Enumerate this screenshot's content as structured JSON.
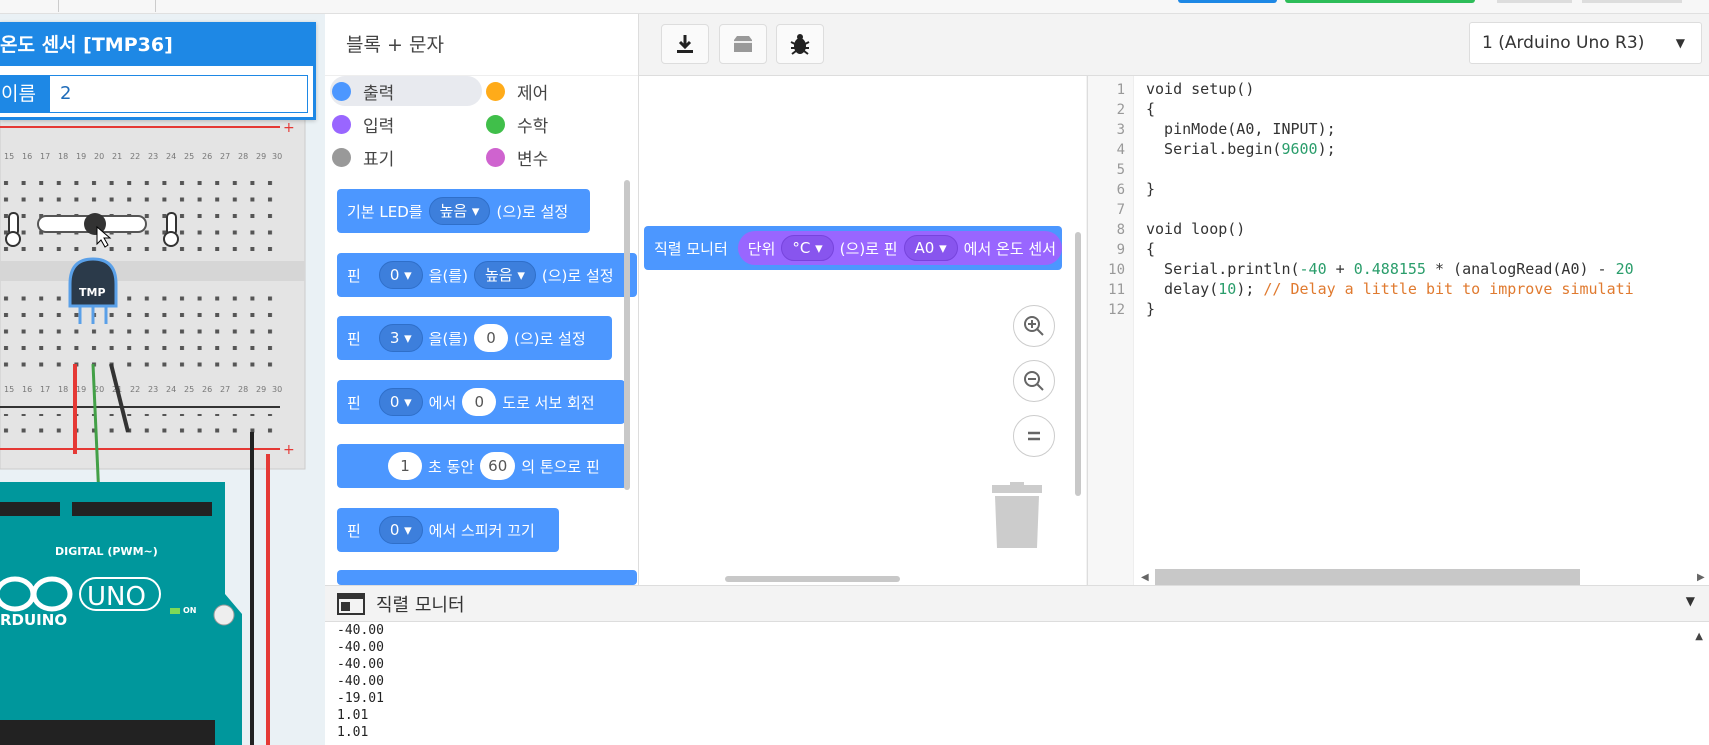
{
  "inspector": {
    "title": "온도 센서 [TMP36]",
    "name_label": "이름",
    "name_value": "2"
  },
  "palette": {
    "header": "블록 + 문자",
    "categories": [
      {
        "label": "출력",
        "color": "#4c97ff"
      },
      {
        "label": "제어",
        "color": "#ffab19"
      },
      {
        "label": "입력",
        "color": "#9966ff"
      },
      {
        "label": "수학",
        "color": "#40bf4a"
      },
      {
        "label": "표기",
        "color": "#999999"
      },
      {
        "label": "변수",
        "color": "#cf63cf"
      }
    ],
    "blocks": {
      "b1": {
        "text1": "기본 LED를",
        "dd1": "높음 ▾",
        "text2": "(으)로 설정"
      },
      "b2": {
        "text1": "핀",
        "dd1": "0 ▾",
        "text2": "을(를)",
        "dd2": "높음 ▾",
        "text3": "(으)로 설정"
      },
      "b3": {
        "text1": "핀",
        "dd1": "3 ▾",
        "text2": "을(를)",
        "num1": "0",
        "text3": "(으)로 설정"
      },
      "b4": {
        "text1": "핀",
        "dd1": "0 ▾",
        "text2": "에서",
        "num1": "0",
        "text3": "도로 서보 회전"
      },
      "b5": {
        "num1": "1",
        "text1": "초 동안",
        "num2": "60",
        "text2": "의 톤으로 핀"
      },
      "b6": {
        "text1": "핀",
        "dd1": "0 ▾",
        "text2": "에서 스피커 끄기"
      }
    }
  },
  "board_select": {
    "value": "1 (Arduino Uno R3)"
  },
  "workspace": {
    "serial_block": {
      "label": "직렬 모니터",
      "unit_label": "단위",
      "unit": "°C ▾",
      "text1": "(으)로 핀",
      "pin": "A0 ▾",
      "text2": "에서 온도 센서"
    }
  },
  "code": {
    "lines": [
      {
        "num": "1",
        "text": "void setup()"
      },
      {
        "num": "2",
        "text": "{"
      },
      {
        "num": "3",
        "text": "  pinMode(A0, INPUT);"
      },
      {
        "num": "4",
        "text": "  Serial.begin(9600);"
      },
      {
        "num": "5",
        "text": ""
      },
      {
        "num": "6",
        "text": "}"
      },
      {
        "num": "7",
        "text": ""
      },
      {
        "num": "8",
        "text": "void loop()"
      },
      {
        "num": "9",
        "text": "{"
      },
      {
        "num": "10",
        "text": "  Serial.println(-40 + 0.488155 * (analogRead(A0) - 20"
      },
      {
        "num": "11",
        "text": "  delay(10); // Delay a little bit to improve simulati"
      },
      {
        "num": "12",
        "text": "}"
      }
    ]
  },
  "serial": {
    "title": "직렬 모니터",
    "output": [
      "-40.00",
      "-40.00",
      "-40.00",
      "-40.00",
      "-19.01",
      "1.01",
      "1.01"
    ]
  },
  "board": {
    "tmp_label": "TMP",
    "digital_label": "DIGITAL (PWM~)",
    "uno_label": "UNO",
    "arduino_label": "RDUINO",
    "on_label": "ON"
  },
  "colors": {
    "accent": "#1e88e5",
    "block_blue": "#4c97ff",
    "block_purple": "#9966ff",
    "arduino_teal": "#00979c"
  }
}
